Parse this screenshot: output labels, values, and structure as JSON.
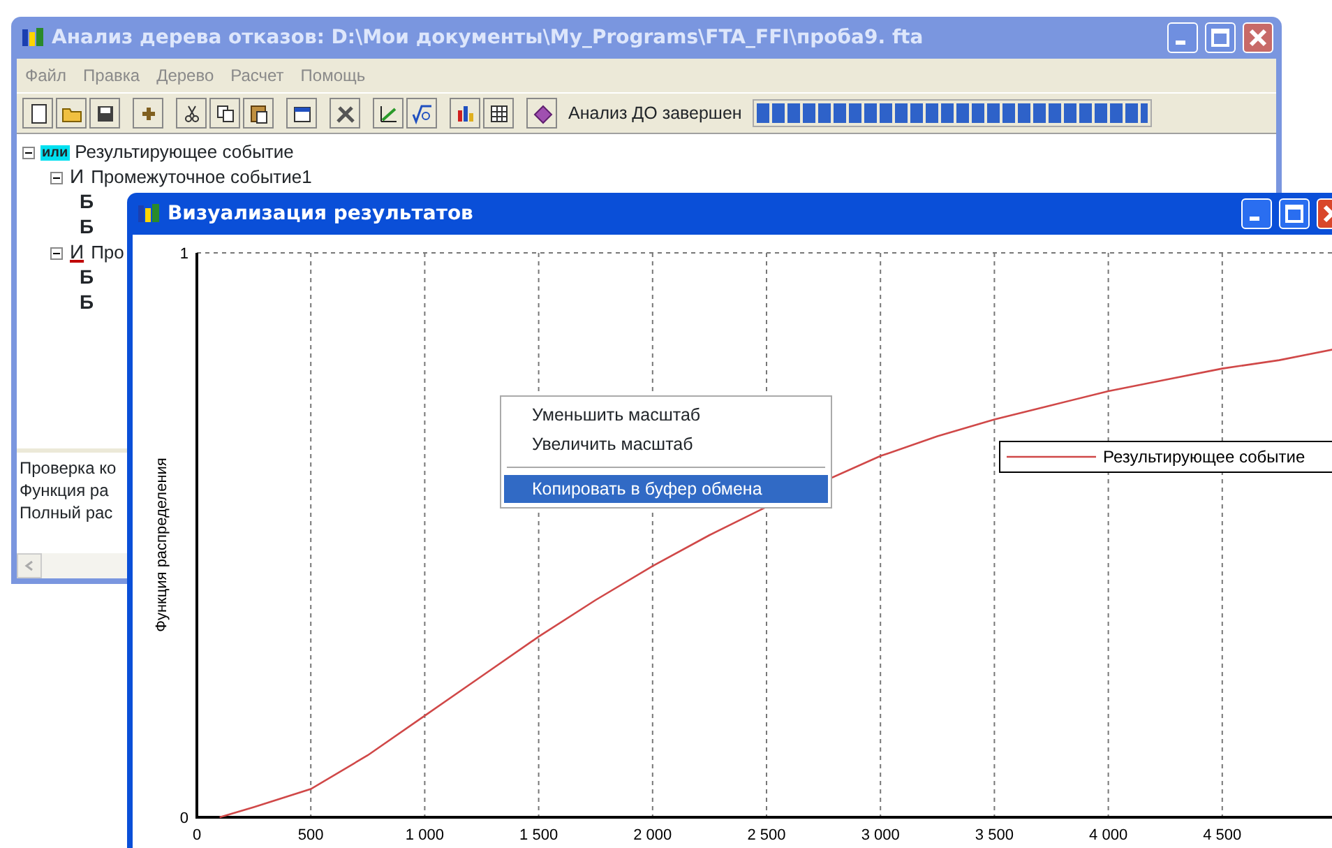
{
  "main_window": {
    "title": "Анализ дерева отказов: D:\\Мои документы\\My_Programs\\FTA_FFI\\проба9. fta",
    "active": false,
    "menu": [
      "Файл",
      "Правка",
      "Дерево",
      "Расчет",
      "Помощь"
    ],
    "toolbar": {
      "status": "Анализ ДО завершен",
      "progress": {
        "level": 1
      }
    },
    "tree": [
      {
        "kind": "or",
        "gate": "или",
        "label": "Результирующее событие",
        "expanded": true,
        "children": [
          {
            "kind": "and",
            "gate": "И",
            "label": "Промежуточное событие1",
            "expanded": true,
            "flagged": false,
            "children": [
              {
                "kind": "basic",
                "gate": "Б"
              },
              {
                "kind": "basic",
                "gate": "Б"
              }
            ]
          },
          {
            "kind": "and",
            "gate": "И",
            "label": "Про",
            "expanded": true,
            "flagged": true,
            "children": [
              {
                "kind": "basic",
                "gate": "Б"
              },
              {
                "kind": "basic",
                "gate": "Б"
              }
            ]
          }
        ]
      }
    ],
    "log": [
      "Проверка ко",
      "Функция ра",
      "Полный рас"
    ]
  },
  "chart_window": {
    "title": "Визуализация результатов",
    "active": true,
    "chart_data": {
      "type": "line",
      "ylabel": "Функция распределения",
      "xlim": [
        0,
        5000
      ],
      "ylim": [
        0,
        1
      ],
      "x": [
        100,
        250,
        500,
        750,
        1000,
        1250,
        1500,
        1750,
        2000,
        2250,
        2500,
        3000,
        3250,
        3500,
        3750,
        4000,
        4250,
        4500,
        4750,
        5000
      ],
      "series": [
        {
          "name": "Результирующее событие",
          "color": "#d04848",
          "values": [
            0,
            0.018,
            0.05,
            0.11,
            0.18,
            0.25,
            0.32,
            0.385,
            0.445,
            0.5,
            0.55,
            0.64,
            0.675,
            0.705,
            0.73,
            0.755,
            0.775,
            0.795,
            0.81,
            0.83
          ]
        }
      ],
      "xticks": [
        0,
        500,
        {
          "value": 1000,
          "label": "1 000"
        },
        {
          "value": 1500,
          "label": "1 500"
        },
        {
          "value": 2000,
          "label": "2 000"
        },
        {
          "value": 2500,
          "label": "2 500"
        },
        {
          "value": 3000,
          "label": "3 000"
        },
        {
          "value": 3500,
          "label": "3 500"
        },
        {
          "value": 4000,
          "label": "4 000"
        },
        {
          "value": 4500,
          "label": "4 500"
        }
      ],
      "yticks": [
        0,
        1
      ],
      "grid": true
    },
    "context_menu": [
      {
        "kind": "item",
        "label": "Уменьшить масштаб",
        "selected": false
      },
      {
        "kind": "item",
        "label": "Увеличить масштаб",
        "selected": false
      },
      {
        "kind": "separator"
      },
      {
        "kind": "item",
        "label": "Копировать в буфер обмена",
        "selected": true
      }
    ]
  }
}
